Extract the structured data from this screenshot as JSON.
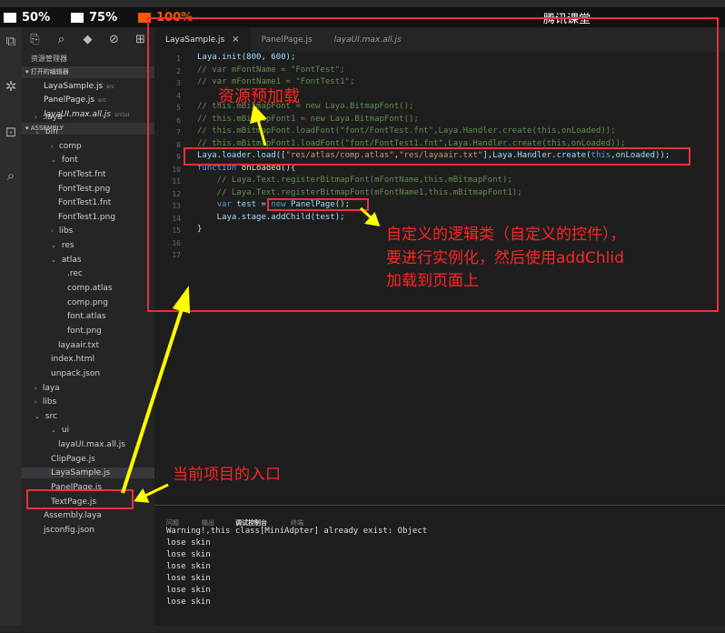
{
  "zoom": [
    {
      "label": "50%"
    },
    {
      "label": "75%"
    },
    {
      "label": "100%"
    }
  ],
  "watermark": "腾讯课堂",
  "sidebar": {
    "title": "资源管理器",
    "open_editors_label": "▾ 打开的编辑器",
    "open_editors": [
      {
        "name": "LayaSample.js",
        "tag": "src"
      },
      {
        "name": "PanelPage.js",
        "tag": "src"
      },
      {
        "name": "layaUI.max.all.js",
        "tag": "src\\ui"
      }
    ],
    "project_label": "▾ ASSEMBLY",
    "tree": [
      {
        "label": ".laya",
        "caret": "›"
      },
      {
        "label": "bin",
        "caret": "⌄"
      },
      {
        "label": "comp",
        "caret": "›"
      },
      {
        "label": "font",
        "caret": "⌄"
      },
      {
        "label": "FontTest.fnt",
        "caret": ""
      },
      {
        "label": "FontTest.png",
        "caret": ""
      },
      {
        "label": "FontTest1.fnt",
        "caret": ""
      },
      {
        "label": "FontTest1.png",
        "caret": ""
      },
      {
        "label": "libs",
        "caret": "›"
      },
      {
        "label": "res",
        "caret": "⌄"
      },
      {
        "label": "atlas",
        "caret": "⌄"
      },
      {
        "label": ".rec",
        "caret": ""
      },
      {
        "label": "comp.atlas",
        "caret": ""
      },
      {
        "label": "comp.png",
        "caret": ""
      },
      {
        "label": "font.atlas",
        "caret": ""
      },
      {
        "label": "font.png",
        "caret": ""
      },
      {
        "label": "layaair.txt",
        "caret": ""
      },
      {
        "label": "index.html",
        "caret": ""
      },
      {
        "label": "unpack.json",
        "caret": ""
      },
      {
        "label": "laya",
        "caret": "›"
      },
      {
        "label": "libs",
        "caret": "›"
      },
      {
        "label": "src",
        "caret": "⌄"
      },
      {
        "label": "ui",
        "caret": "⌄"
      },
      {
        "label": "layaUI.max.all.js",
        "caret": ""
      },
      {
        "label": "ClipPage.js",
        "caret": ""
      },
      {
        "label": "LayaSample.js",
        "caret": ""
      },
      {
        "label": "PanelPage.js",
        "caret": ""
      },
      {
        "label": "TextPage.js",
        "caret": ""
      },
      {
        "label": "Assembly.laya",
        "caret": ""
      },
      {
        "label": "jsconfig.json",
        "caret": ""
      }
    ]
  },
  "editor": {
    "tabs": [
      {
        "label": "LayaSample.js",
        "close": "×"
      },
      {
        "label": "PanelPage.js"
      },
      {
        "label": "layaUI.max.all.js"
      }
    ],
    "line_numbers": [
      "1",
      "2",
      "3",
      "4",
      "5",
      "6",
      "7",
      "8",
      "9",
      "10",
      "11",
      "12",
      "13",
      "14",
      "15",
      "16",
      "17"
    ],
    "lines": [
      [
        {
          "t": "Laya.init(800, 600);",
          "c": "ident"
        }
      ],
      [
        {
          "t": "// var mFontName = \"FontTest\";",
          "c": "comment"
        }
      ],
      [
        {
          "t": "// var mFontName1 = \"FontTest1\";",
          "c": "comment"
        }
      ],
      [
        {
          "t": "",
          "c": "plain"
        }
      ],
      [
        {
          "t": "// this.mBitmapFont = new Laya.BitmapFont();",
          "c": "comment"
        }
      ],
      [
        {
          "t": "// this.mBitmapFont1 = new Laya.BitmapFont();",
          "c": "comment"
        }
      ],
      [
        {
          "t": "// this.mBitmapFont.loadFont(\"font/FontTest.fnt\",Laya.Handler.create(this,onLoaded));",
          "c": "comment"
        }
      ],
      [
        {
          "t": "// this.mBitmapFont1.loadFont(\"font/FontTest1.fnt\",Laya.Handler.create(this,onLoaded));",
          "c": "comment"
        }
      ],
      [
        {
          "t": "Laya.loader.load([",
          "c": "ident"
        },
        {
          "t": "\"res/atlas/comp.atlas\"",
          "c": "str"
        },
        {
          "t": ",",
          "c": "plain"
        },
        {
          "t": "\"res/layaair.txt\"",
          "c": "str"
        },
        {
          "t": "],Laya.Handler.create(",
          "c": "ident"
        },
        {
          "t": "this",
          "c": "kw"
        },
        {
          "t": ",onLoaded));",
          "c": "ident"
        }
      ],
      [
        {
          "t": "function ",
          "c": "kw"
        },
        {
          "t": "onLoaded",
          "c": "fn"
        },
        {
          "t": "(){",
          "c": "plain"
        }
      ],
      [
        {
          "t": "    // Laya.Text.registerBitmapFont(mFontName,this.mBitmapFont);",
          "c": "comment"
        }
      ],
      [
        {
          "t": "    // Laya.Text.registerBitmapFont(mFontName1,this.mBitmapFont1);",
          "c": "comment"
        }
      ],
      [
        {
          "t": "    ",
          "c": "plain"
        },
        {
          "t": "var ",
          "c": "kw"
        },
        {
          "t": "test = ",
          "c": "ident"
        },
        {
          "t": "new ",
          "c": "kw"
        },
        {
          "t": "PanelPage",
          "c": "ident"
        },
        {
          "t": "();",
          "c": "plain"
        }
      ],
      [
        {
          "t": "    Laya.stage.addChild(test);",
          "c": "ident"
        }
      ],
      [
        {
          "t": "}",
          "c": "plain"
        }
      ],
      [
        {
          "t": "",
          "c": "plain"
        }
      ],
      [
        {
          "t": "",
          "c": "plain"
        }
      ]
    ]
  },
  "panel": {
    "tabs": [
      "问题",
      "输出",
      "调试控制台",
      "终端"
    ],
    "output": [
      "Warning!,this class[MiniAdpter] already exist: Object",
      "lose skin",
      "lose skin",
      "lose skin",
      "lose skin",
      "lose skin",
      "lose skin"
    ]
  },
  "annotations": {
    "preload": "资源预加载",
    "custom_line1": "自定义的逻辑类（自定义的控件），",
    "custom_line2": "要进行实例化，然后使用addChlid",
    "custom_line3": "加载到页面上",
    "entry": "当前项目的入口"
  },
  "colors": {
    "annotation": "#e8303a",
    "arrow": "#ffff00",
    "accent": "#f05a00"
  }
}
